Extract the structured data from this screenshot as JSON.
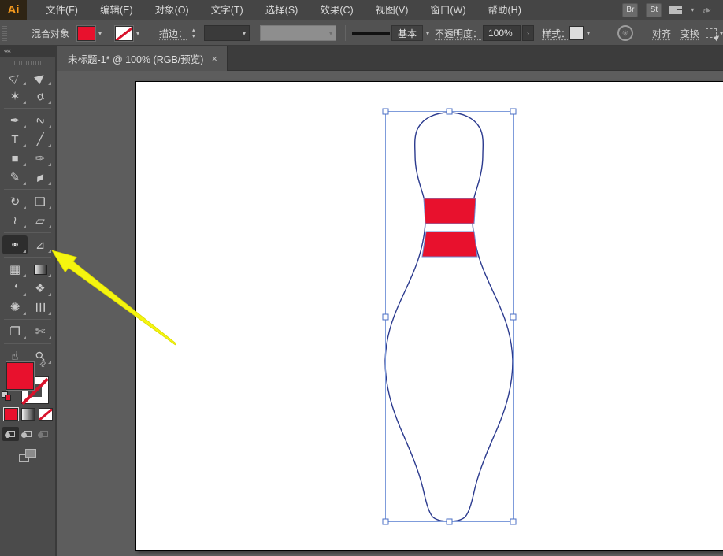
{
  "menu_bar": {
    "logo_text": "Ai",
    "items": [
      "文件(F)",
      "编辑(E)",
      "对象(O)",
      "文字(T)",
      "选择(S)",
      "效果(C)",
      "视图(V)",
      "窗口(W)",
      "帮助(H)"
    ],
    "bridge_button": "Br",
    "style_button": "St",
    "workspace_chevron": "▾",
    "launch_glyph": "❧"
  },
  "control_panel": {
    "context_label": "混合对象",
    "fill_color": "#E8112D",
    "stroke_label": "描边：",
    "stroke_weight_value": "",
    "brush_definition_value": "",
    "stepper_up": "▴",
    "stepper_down": "▾",
    "chevron": "▾",
    "variable_width_label": "基本",
    "opacity_label": "不透明度：",
    "opacity_value": "100%",
    "flyout_glyph": "›",
    "style_label": "样式：",
    "recolor_glyph": "✳",
    "align_label": "对齐",
    "transform_label": "变换"
  },
  "document_tab": {
    "title": "未标题-1* @ 100% (RGB/预览)",
    "close_glyph": "×"
  },
  "toolbar": {
    "collapse_glyph": "««",
    "tools": [
      {
        "id": "selection-tool",
        "glyph": "▷",
        "rot": -40
      },
      {
        "id": "direct-selection-tool",
        "glyph": "▶",
        "rot": -40
      },
      {
        "id": "magic-wand-tool",
        "glyph": "✶",
        "rot": 0
      },
      {
        "id": "lasso-tool",
        "glyph": "α",
        "rot": -15
      },
      {
        "id": "pen-tool",
        "glyph": "✒",
        "rot": 0
      },
      {
        "id": "curvature-tool",
        "glyph": "∿",
        "rot": -20
      },
      {
        "id": "type-tool",
        "glyph": "T",
        "rot": 0
      },
      {
        "id": "line-segment-tool",
        "glyph": "╱",
        "rot": 0
      },
      {
        "id": "rectangle-tool",
        "glyph": "■",
        "rot": 0
      },
      {
        "id": "paintbrush-tool",
        "glyph": "✑",
        "rot": 0
      },
      {
        "id": "shaper-tool",
        "glyph": "✎",
        "rot": 0
      },
      {
        "id": "eraser-tool",
        "glyph": "▰",
        "rot": -25
      },
      {
        "id": "rotate-tool",
        "glyph": "↻",
        "rot": 0
      },
      {
        "id": "scale-tool",
        "glyph": "❏",
        "rot": 0
      },
      {
        "id": "width-tool",
        "glyph": "≀",
        "rot": 0
      },
      {
        "id": "free-transform-tool",
        "glyph": "▱",
        "rot": 0
      },
      {
        "id": "shape-builder-tool",
        "glyph": "⚭",
        "rot": 0,
        "active": true
      },
      {
        "id": "perspective-grid-tool",
        "glyph": "⊿",
        "rot": 0
      },
      {
        "id": "mesh-tool",
        "glyph": "▦",
        "rot": 0
      },
      {
        "id": "gradient-tool",
        "glyph": "",
        "rot": 0,
        "cls": "grad-sq"
      },
      {
        "id": "eyedropper-tool",
        "glyph": "❛",
        "rot": 15
      },
      {
        "id": "blend-tool",
        "glyph": "❖",
        "rot": 0
      },
      {
        "id": "symbol-sprayer-tool",
        "glyph": "✺",
        "rot": 0
      },
      {
        "id": "column-graph-tool",
        "glyph": "☰",
        "rot": 90
      },
      {
        "id": "artboard-tool",
        "glyph": "❐",
        "rot": 0
      },
      {
        "id": "slice-tool",
        "glyph": "✄",
        "rot": 0
      },
      {
        "id": "hand-tool",
        "glyph": "☝",
        "rot": 0
      },
      {
        "id": "zoom-tool",
        "glyph": "⚲",
        "rot": -45
      }
    ]
  },
  "canvas": {
    "object": {
      "type": "bowling-pin",
      "stripe_count": 2,
      "stripe_color": "#E8112D",
      "stripe_edge_color": "#6C87CF",
      "outline_color": "#2B3A8E",
      "selection_box_color": "#7F9CDB",
      "handle_border_color": "#4B6FC4"
    },
    "annotation_arrow_color": "#F5F50F"
  }
}
